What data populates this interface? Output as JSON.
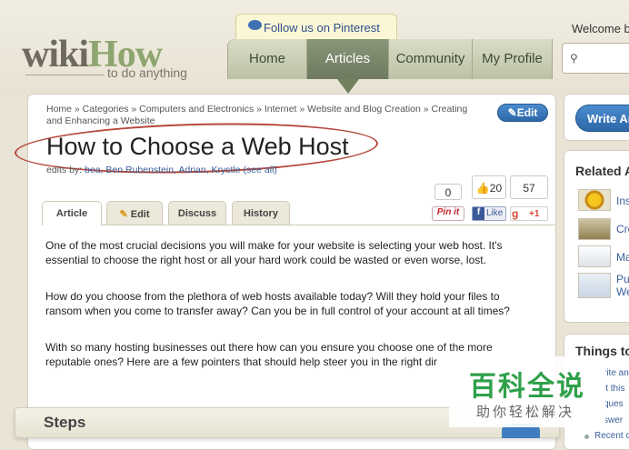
{
  "header": {
    "logo_part1": "wiki",
    "logo_part2": "How",
    "tagline": "to do anything",
    "pinterest": "Follow us on Pinterest",
    "welcome": "Welcome b",
    "nav": [
      "Home",
      "Articles",
      "Community",
      "My Profile"
    ]
  },
  "article": {
    "breadcrumb": "Home » Categories » Computers and Electronics » Internet » Website and Blog Creation » Creating and Enhancing a Website",
    "title": "How to Choose a Web Host",
    "edits_prefix": "edits by: ",
    "editors": "bea, Ben Rubenstein, Adrian, Krystle (see all)",
    "edit_button": "✎Edit",
    "tabs": [
      "Article",
      "Edit",
      "Discuss",
      "History"
    ],
    "paragraphs": [
      "One of the most crucial decisions you will make for your website is selecting your web host. It's essential to choose the right host or all your hard work could be wasted or even worse, lost.",
      "How do you choose from the plethora of web hosts available today? Will they hold your files to ransom when you come to transfer away? Can you be in full control of your account at all times?",
      "With so many hosting businesses out there how can you ensure you choose one of the more reputable ones? Here are a few pointers that should help steer you in the right dir"
    ],
    "steps_heading": "Steps"
  },
  "share": {
    "pin_count": "0",
    "pin_label": "Pin it",
    "like_count": "20",
    "like_label": "Like",
    "gplus_count": "57",
    "gplus_label": "+1"
  },
  "sidebar": {
    "write_button": "Write Ar",
    "related_title": "Related A",
    "related_items": [
      "Ins",
      "Cre",
      "Ma",
      "Pu",
      "We"
    ],
    "things_title": "Things to",
    "things_items": [
      "rite an",
      "it this",
      "ques",
      "swer",
      "Recent c"
    ]
  },
  "watermark": {
    "main": "百科全说",
    "sub": "助你轻松解决"
  }
}
